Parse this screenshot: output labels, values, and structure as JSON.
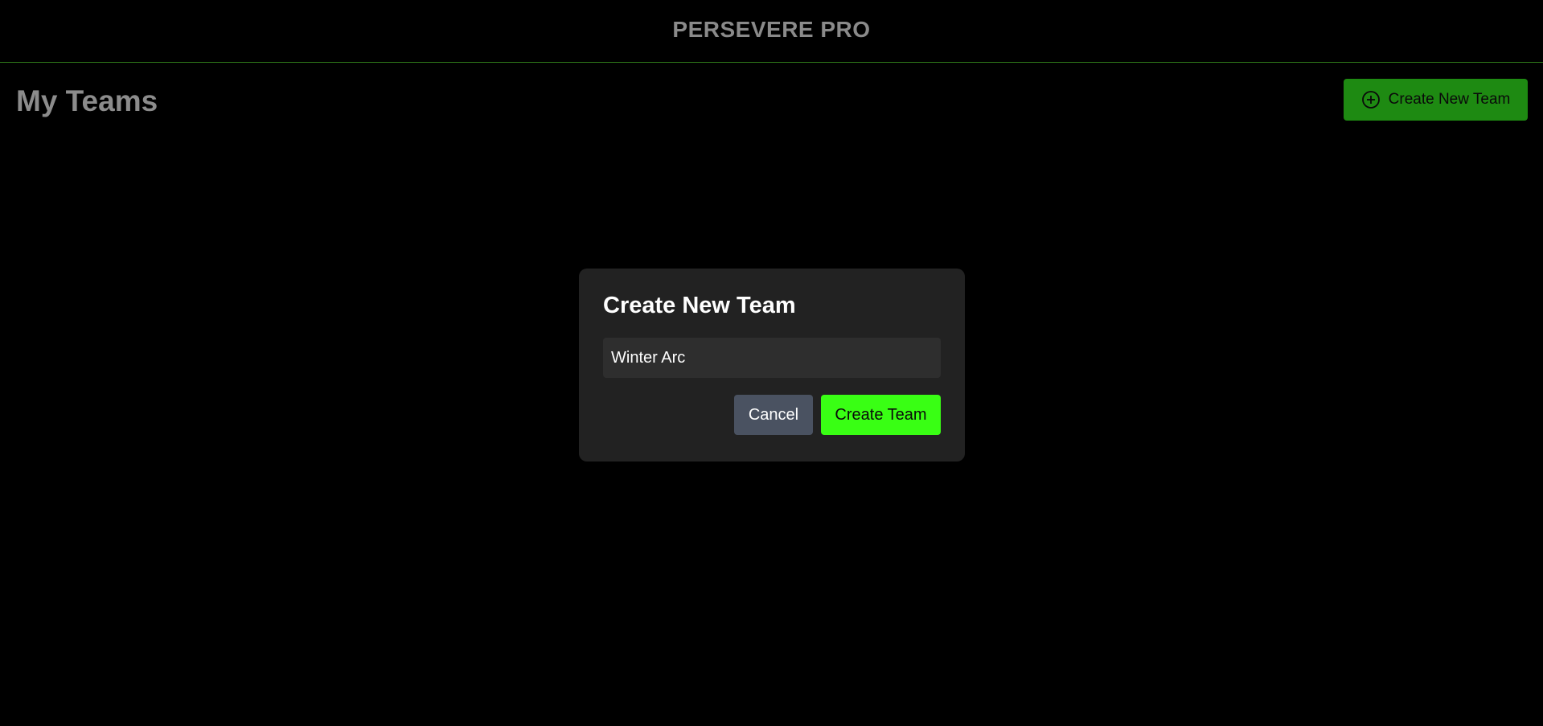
{
  "header": {
    "brand": "PERSEVERE PRO"
  },
  "page": {
    "title": "My Teams"
  },
  "toolbar": {
    "create_new_team_label": "Create New Team",
    "create_new_team_icon": "plus-circle-icon"
  },
  "modal": {
    "title": "Create New Team",
    "team_name_value": "Winter Arc",
    "cancel_label": "Cancel",
    "create_label": "Create Team"
  },
  "colors": {
    "background": "#000000",
    "accent_green": "#39ff14",
    "dark_green": "#1e8a12",
    "header_border": "#2f7a1a",
    "modal_bg": "#222222",
    "cancel_bg": "#4a5261"
  }
}
